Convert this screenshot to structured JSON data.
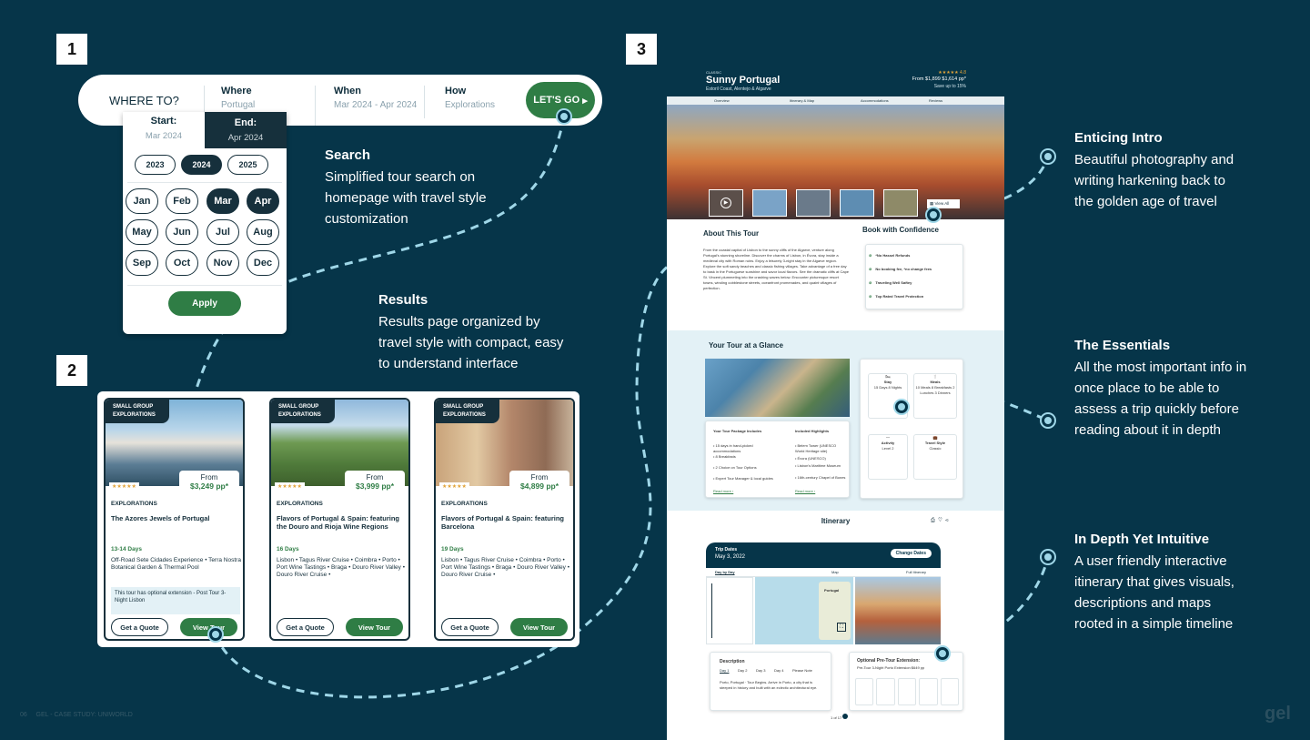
{
  "steps": [
    "1",
    "2",
    "3"
  ],
  "search": {
    "where_to": "WHERE TO?",
    "where_label": "Where",
    "where_value": "Portugal",
    "when_label": "When",
    "when_value": "Mar 2024 - Apr 2024",
    "how_label": "How",
    "how_value": "Explorations",
    "cta": "LET'S GO"
  },
  "calendar": {
    "start_label": "Start:",
    "start_value": "Mar 2024",
    "end_label": "End:",
    "end_value": "Apr 2024",
    "years": [
      "2023",
      "2024",
      "2025"
    ],
    "selected_year": "2024",
    "months": [
      "Jan",
      "Feb",
      "Mar",
      "Apr",
      "May",
      "Jun",
      "Jul",
      "Aug",
      "Sep",
      "Oct",
      "Nov",
      "Dec"
    ],
    "selected_months": [
      "Mar",
      "Apr"
    ],
    "apply": "Apply"
  },
  "notes": {
    "search_title": "Search",
    "search_body": "Simplified tour search on homepage with travel style customization",
    "results_title": "Results",
    "results_body": "Results page organized by travel style with compact, easy to understand interface",
    "intro_title": "Enticing Intro",
    "intro_body": "Beautiful photography and writing harkening back to the golden age of travel",
    "essentials_title": "The Essentials",
    "essentials_body": "All the most important info in once place to be able to assess a trip quickly before reading about it in depth",
    "depth_title": "In Depth Yet Intuitive",
    "depth_body": "A user friendly interactive itinerary that gives visuals, descriptions and maps rooted in a simple timeline"
  },
  "results": {
    "cards": [
      {
        "tag": "SMALL GROUP EXPLORATIONS",
        "stars": "★★★★★",
        "from": "From",
        "price": "$3,249 pp*",
        "style": "EXPLORATIONS",
        "name": "The Azores Jewels of Portugal",
        "days": "13-14 Days",
        "route": "Off-Road Sete Cidades Experience • Terra Nostra Botanical Garden & Thermal Pool",
        "ext": "This tour has optional extension - Post Tour 3-Night Lisbon",
        "quote": "Get a Quote",
        "view": "View Tour"
      },
      {
        "tag": "SMALL GROUP EXPLORATIONS",
        "stars": "★★★★★",
        "from": "From",
        "price": "$3,999 pp*",
        "style": "EXPLORATIONS",
        "name": "Flavors of Portugal & Spain: featuring the Douro and Rioja Wine Regions",
        "days": "16 Days",
        "route": "Lisbon • Tagus River Cruise • Coimbra • Porto • Port Wine Tastings • Braga • Douro River Valley • Douro River Cruise •",
        "ext": "",
        "quote": "Get a Quote",
        "view": "View Tour"
      },
      {
        "tag": "SMALL GROUP EXPLORATIONS",
        "stars": "★★★★★",
        "from": "From",
        "price": "$4,899 pp*",
        "style": "EXPLORATIONS",
        "name": "Flavors of Portugal & Spain: featuring Barcelona",
        "days": "19 Days",
        "route": "Lisbon • Tagus River Cruise • Coimbra • Porto • Port Wine Tastings • Braga • Douro River Valley • Douro River Cruise •",
        "ext": "",
        "quote": "Get a Quote",
        "view": "View Tour"
      }
    ]
  },
  "tour": {
    "eyebrow": "CLASSIC",
    "title": "Sunny Portugal",
    "subtitle": "Estoril Coast, Alentejo & Algarve",
    "rating": "★★★★★ 4.8",
    "price_line": "From $1,899 $1,614 pp*",
    "save_line": "Save up to 15%",
    "nav": [
      "Overview",
      "Itinerary & Map",
      "Accommodations",
      "Reviews"
    ],
    "view_all": "View All",
    "about_title": "About This Tour",
    "about_text": "From the coastal capital of Lisbon to the sunny cliffs of the Algarve, venture along Portugal's stunning shoreline. Discover the charms of Lisbon, in Évora, stay inside a medieval city with Roman ruins. Enjoy a leisurely 3-night stay in the Algarve region. Explore the soft sandy beaches and classic fishing villages. Take advantage of a free day to bask in the Portuguese sunshine and savor local flavors. See the dramatic cliffs at Cape St. Vincent plummeting into the crashing waves below. Encounter picturesque resort towns, winding cobblestone streets, oceanfront promenades, and quaint villages of perfection.",
    "book_title": "Book with Confidence",
    "book_items": [
      "*No Hassel Refunds",
      "No booking fee, *no change fees",
      "Traveling Well Saftey",
      "Top Rated Travel Protection"
    ],
    "glance_title": "Your Tour at a Glance",
    "package_title": "Your Tour Package Includes",
    "package_items": [
      "• 15 days in hand-picked accommodations",
      "• 8 Breakfasts",
      "• 2 Choice on Tour Options",
      "• Expert Tour Manager & local guides"
    ],
    "highlights_title": "Included Highlights",
    "highlights_items": [
      "• Belem Tower (UNESCO World Heritage site)",
      "• Évora (UNESCO)",
      "• Lisbon's Maritime Museum",
      "• 16th-century Chapel of Bones"
    ],
    "read_more": "Read more ›",
    "stats": [
      {
        "label": "Stay",
        "value": "15 Days 8 Nights"
      },
      {
        "label": "Meals",
        "value": "10 Meals 8 Breakfasts 2 Lunches 3 Dinners"
      },
      {
        "label": "Activity",
        "value": "Level 2"
      },
      {
        "label": "Travel Style",
        "value": "Classic"
      }
    ],
    "itinerary_title": "Itinerary",
    "trip_dates_label": "Trip Dates",
    "trip_dates_value": "May 3, 2022",
    "change_dates": "Change Dates",
    "itin_tabs": [
      "Day by Day",
      "Map",
      "Full Itinerary"
    ],
    "map_label": "Portugal",
    "description_title": "Description",
    "day_tabs": [
      "Day 1",
      "Day 2",
      "Day 3",
      "Day 4",
      "Please Note"
    ],
    "desc_text": "Porto, Portugal · Tour Begins. Arrive in Porto, a city that is steeped in history and built with an eclectic architectural eye.",
    "ext_title": "Optional Pre-Tour Extension:",
    "ext_value": "Pre-Tour 3-Night Porto Extension $649 pp",
    "pager": "1 of 17"
  },
  "footer": {
    "left": "06     GEL - CASE STUDY: UNIWORLD",
    "logo": "gel"
  }
}
